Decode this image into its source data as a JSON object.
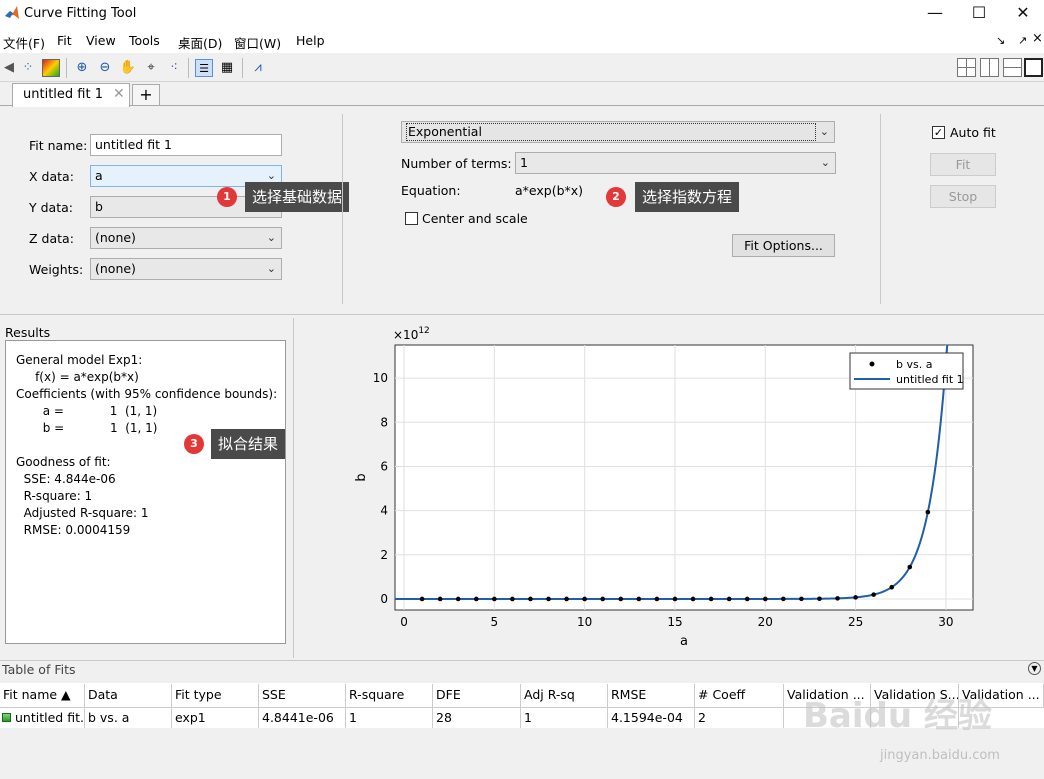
{
  "window": {
    "title": "Curve Fitting Tool"
  },
  "menu": [
    "文件(F)",
    "Fit",
    "View",
    "Tools",
    "桌面(D)",
    "窗口(W)",
    "Help"
  ],
  "tabs": {
    "active": "untitled fit 1",
    "add_label": "+"
  },
  "fit": {
    "fit_name_label": "Fit name:",
    "fit_name_value": "untitled fit 1",
    "x_label": "X data:",
    "x_value": "a",
    "y_label": "Y data:",
    "y_value": "b",
    "z_label": "Z data:",
    "z_value": "(none)",
    "weights_label": "Weights:",
    "weights_value": "(none)",
    "model_type": "Exponential",
    "terms_label": "Number of terms:",
    "terms_value": "1",
    "equation_label": "Equation:",
    "equation_value": "a*exp(b*x)",
    "center_scale_label": "Center and scale",
    "fit_options_label": "Fit Options...",
    "auto_fit_label": "Auto fit",
    "fit_button": "Fit",
    "stop_button": "Stop"
  },
  "annotations": [
    {
      "num": "1",
      "text": "选择基础数据"
    },
    {
      "num": "2",
      "text": "选择指数方程"
    },
    {
      "num": "3",
      "text": "拟合结果"
    }
  ],
  "results": {
    "header": "Results",
    "lines": [
      "General model Exp1:",
      "     f(x) = a*exp(b*x)",
      "Coefficients (with 95% confidence bounds):",
      "       a =            1  (1, 1)",
      "       b =            1  (1, 1)",
      "",
      "Goodness of fit:",
      "  SSE: 4.844e-06",
      "  R-square: 1",
      "  Adjusted R-square: 1",
      "  RMSE: 0.0004159"
    ]
  },
  "chart_data": {
    "type": "scatter",
    "xlabel": "a",
    "ylabel": "b",
    "exponent_label": "×10",
    "exponent_power": "12",
    "xlim": [
      -0.5,
      31.5
    ],
    "ylim": [
      -0.5,
      11.5
    ],
    "xticks": [
      0,
      5,
      10,
      15,
      20,
      25,
      30
    ],
    "yticks": [
      0,
      2,
      4,
      6,
      8,
      10
    ],
    "grid": true,
    "legend_position": "top-right",
    "series": [
      {
        "name": "b vs. a",
        "kind": "points",
        "x": [
          1,
          2,
          3,
          4,
          5,
          6,
          7,
          8,
          9,
          10,
          11,
          12,
          13,
          14,
          15,
          16,
          17,
          18,
          19,
          20,
          21,
          22,
          23,
          24,
          25,
          26,
          27,
          28,
          29
        ],
        "y": [
          0,
          0,
          0,
          0,
          0,
          0,
          0,
          0,
          0,
          0,
          0,
          0,
          0,
          0,
          0,
          0,
          0,
          0,
          0,
          0.0005,
          0.0013,
          0.0036,
          0.0097,
          0.0265,
          0.072,
          0.196,
          0.532,
          1.446,
          3.931
        ]
      },
      {
        "name": "untitled fit 1",
        "kind": "line",
        "function": "exp(x)/1e12"
      }
    ]
  },
  "table_of_fits": {
    "title": "Table of Fits",
    "columns": [
      "Fit name ▲",
      "Data",
      "Fit type",
      "SSE",
      "R-square",
      "DFE",
      "Adj R-sq",
      "RMSE",
      "# Coeff",
      "Validation ...",
      "Validation S...",
      "Validation ..."
    ],
    "rows": [
      [
        "untitled fit...",
        "b vs. a",
        "exp1",
        "4.8441e-06",
        "1",
        "28",
        "1",
        "4.1594e-04",
        "2",
        "",
        "",
        ""
      ]
    ]
  },
  "watermark": {
    "main": "Baidu 经验",
    "sub": "jingyan.baidu.com"
  },
  "colors": {
    "fit_line": "#1f5fa6",
    "callout_bg": "#4a4a4a",
    "badge": "#e23838"
  }
}
